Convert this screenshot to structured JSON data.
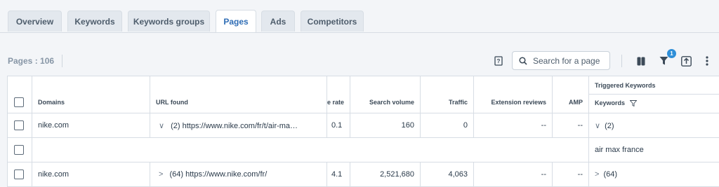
{
  "tabs": [
    {
      "label": "Overview",
      "active": false
    },
    {
      "label": "Keywords",
      "active": false
    },
    {
      "label": "Keywords groups",
      "active": false
    },
    {
      "label": "Pages",
      "active": true
    },
    {
      "label": "Ads",
      "active": false
    },
    {
      "label": "Competitors",
      "active": false
    }
  ],
  "toolbar": {
    "pages_count": "Pages : 106",
    "search_placeholder": "Search for a page",
    "filter_badge": "1"
  },
  "table": {
    "group_header": "Triggered Keywords",
    "columns": {
      "domains": "Domains",
      "url_found": "URL found",
      "rate": "e rate",
      "search_volume": "Search volume",
      "traffic": "Traffic",
      "extension_reviews": "Extension reviews",
      "amp": "AMP",
      "keywords": "Keywords"
    },
    "rows": [
      {
        "domain": "nike.com",
        "url_chevron": "∨",
        "url": "(2) https://www.nike.com/fr/t/air-ma…",
        "rate": "0.1",
        "search_volume": "160",
        "traffic": "0",
        "extension_reviews": "--",
        "amp": "--",
        "kw_chevron": "∨",
        "keywords": "(2)"
      },
      {
        "sub_keyword": "air max france"
      },
      {
        "domain": "nike.com",
        "url_chevron": ">",
        "url": "(64) https://www.nike.com/fr/",
        "rate": "4.1",
        "search_volume": "2,521,680",
        "traffic": "4,063",
        "extension_reviews": "--",
        "amp": "--",
        "kw_chevron": ">",
        "keywords": "(64)"
      }
    ]
  },
  "colors": {
    "active_tab_text": "#2f6db5",
    "badge": "#2f8fd8",
    "background": "#f3f5f8"
  }
}
